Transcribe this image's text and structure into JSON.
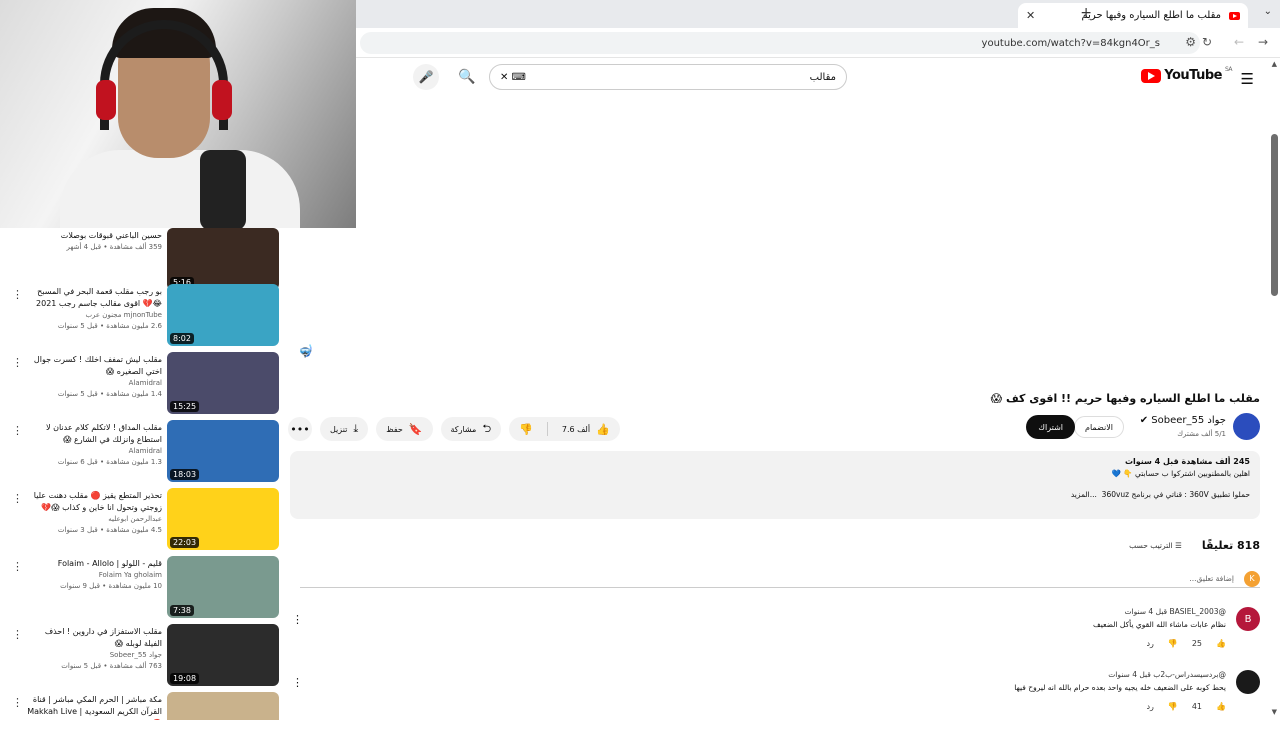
{
  "browser": {
    "tab_title": "مقلب ما اطلع السياره وفيها حريم",
    "url": "youtube.com/watch?v=84kgn4Or_s"
  },
  "header": {
    "logo_text": "YouTube",
    "logo_region": "SA",
    "search_value": "مقالب"
  },
  "video": {
    "title": "مقلب ما اطلع السياره وفيها حريم !! اقوى كف 😱",
    "channel": "جواد Sobeer_55",
    "subscribers": "5/1 ألف مشترك",
    "join_label": "الانضمام",
    "subscribe_label": "اشتراك",
    "likes": "7.6 ألف",
    "share_label": "مشاركة",
    "save_label": "حفظ",
    "download_label": "تنزيل",
    "more_icon": "more-icon"
  },
  "description": {
    "stats": "245 ألف مشاهدة  قبل 4 سنوات",
    "line1": "اهلين بالمطنوبين اشتركوا ب حسابتي 👇 💙",
    "promo": "حملوا تطبيق 360V : قناتي في برنامج 360vuz",
    "more": "...المزيد"
  },
  "comments": {
    "count": "818 تعليقًا",
    "sort_label": "الترتيب حسب",
    "add_placeholder": "إضافة تعليق...",
    "me_initial": "K",
    "items": [
      {
        "initial": "B",
        "color": "#b5173b",
        "author": "@BASIEL_2003  قبل 4 سنوات",
        "text": "نظام عابات ماشاء الله القوي يأكل الضعيف",
        "likes": "25",
        "reply": "رد"
      },
      {
        "initial": "",
        "color": "#1a1a1a",
        "author": "@بردسيسدراس-ب2ب  قبل 4 سنوات",
        "text": "يحط كوبه على الضعيف خله يجيه واحد بعده حرام بالله انه ليروح فيها",
        "likes": "41",
        "reply": "رد"
      }
    ]
  },
  "recommendations": [
    {
      "title": "حسين الباعني قبوقات بوصلات",
      "channel": "",
      "meta": "359 ألف مشاهدة • قبل 4 أشهر",
      "duration": "5:16",
      "thumb": "#3b2a22"
    },
    {
      "title": "بو رجب مقلب قعمة البحر في المسبح 😂💔 اقوى مقالب جاسم رجب 2021",
      "channel": "mjnonTube مجنون عرب",
      "meta": "2.6 مليون مشاهدة • قبل 5 سنوات",
      "duration": "8:02",
      "thumb": "#3aa4c4"
    },
    {
      "title": "مقلب ليش تمفف اخلك ! كسرت جوال اختي الصغيره 😱",
      "channel": "Alamidral",
      "meta": "1.4 مليون مشاهدة • قبل 5 سنوات",
      "duration": "15:25",
      "thumb": "#4b4b6a"
    },
    {
      "title": "مقلب المداق ! لاتكلم كلام عدنان لا استطاع وانزلك في الشارع 😱",
      "channel": "Alamidral",
      "meta": "1.3 مليون مشاهدة • قبل 6 سنوات",
      "duration": "18:03",
      "thumb": "#2f6db5"
    },
    {
      "title": "تحذير المتطع يقيز 🔴 مقلب دهنت عليا زوجتي وتحول انا خاين و كذاب 😱💔",
      "channel": "عبدالرحمن ابوعليه",
      "meta": "4.5 مليون مشاهدة • قبل 3 سنوات",
      "duration": "22:03",
      "thumb": "#ffd21a"
    },
    {
      "title": "قليم - اللولو | Folaim - Allolo",
      "channel": "Folaim Ya gholaim",
      "meta": "10 مليون مشاهدة • قبل 9 سنوات",
      "duration": "7:38",
      "thumb": "#7a9a8f"
    },
    {
      "title": "مقلب الاستفزاز في داروين ! احذف الفيلة لوبله 😱",
      "channel": "جواد Sobeer_55",
      "meta": "763 ألف مشاهدة • قبل 5 سنوات",
      "duration": "19:08",
      "thumb": "#2c2c2c"
    },
    {
      "title": "مكة مباشر | الحرم المكي مباشر | قناة القرآن الكريم السعودية | Makkah Live 🔴",
      "channel": "",
      "meta": "",
      "duration": "",
      "thumb": "#c9b28c"
    }
  ]
}
